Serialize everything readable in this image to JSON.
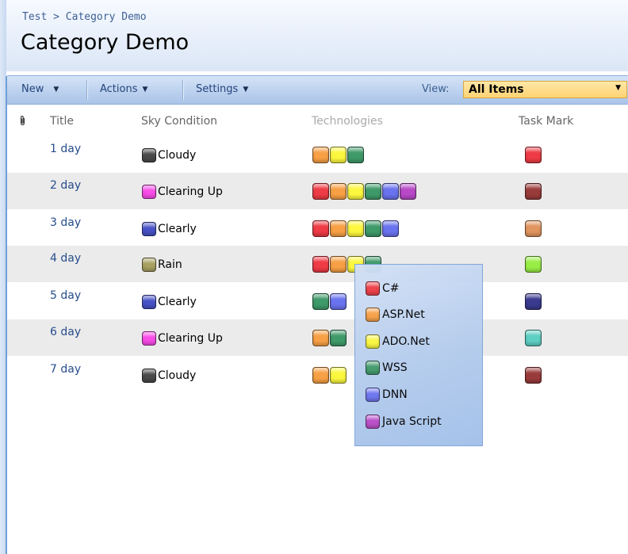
{
  "breadcrumb": {
    "site": "Test",
    "separator": " > ",
    "current": "Category Demo"
  },
  "page_title": "Category Demo",
  "toolbar": {
    "new_label": "New",
    "actions_label": "Actions",
    "settings_label": "Settings",
    "view_label": "View:",
    "view_value": "All Items"
  },
  "columns": {
    "title": "Title",
    "sky": "Sky Condition",
    "tech": "Technologies",
    "task": "Task Mark"
  },
  "colors": {
    "red": "#ee3b45",
    "orange": "#f7a045",
    "yellow": "#fbf73e",
    "green": "#3f9a6a",
    "blue": "#6a73ef",
    "purple": "#b84ac8",
    "gray": "#4a4a4a",
    "pink": "#f94ce8",
    "navy": "#4852c7",
    "olive": "#a8a162",
    "maroon": "#9a3b3b",
    "tan": "#e1955f",
    "lime": "#99ee46",
    "dark_navy": "#3a3a8f",
    "teal": "#5ecfc3",
    "link": "#264d8c",
    "toolbar": "#bcd1ee",
    "view_highlight": "#ffd273"
  },
  "rows": [
    {
      "title": "1 day",
      "sky": "Cloudy",
      "sky_color": "#4a4a4a",
      "tech": [
        "#f7a045",
        "#fbf73e",
        "#3f9a6a"
      ],
      "task": "#ee3b45"
    },
    {
      "title": "2 day",
      "sky": "Clearing Up",
      "sky_color": "#f94ce8",
      "tech": [
        "#ee3b45",
        "#f7a045",
        "#fbf73e",
        "#3f9a6a",
        "#6a73ef",
        "#b84ac8"
      ],
      "task": "#9a3b3b"
    },
    {
      "title": "3 day",
      "sky": "Clearly",
      "sky_color": "#4852c7",
      "tech": [
        "#ee3b45",
        "#f7a045",
        "#fbf73e",
        "#3f9a6a",
        "#6a73ef"
      ],
      "task": "#e1955f"
    },
    {
      "title": "4 day",
      "sky": "Rain",
      "sky_color": "#a8a162",
      "tech": [
        "#ee3b45",
        "#f7a045",
        "#fbf73e",
        "#3f9a6a"
      ],
      "task": "#99ee46"
    },
    {
      "title": "5 day",
      "sky": "Clearly",
      "sky_color": "#4852c7",
      "tech": [
        "#3f9a6a",
        "#6a73ef"
      ],
      "task": "#3a3a8f"
    },
    {
      "title": "6 day",
      "sky": "Clearing Up",
      "sky_color": "#f94ce8",
      "tech": [
        "#f7a045",
        "#3f9a6a"
      ],
      "task": "#5ecfc3"
    },
    {
      "title": "7 day",
      "sky": "Cloudy",
      "sky_color": "#4a4a4a",
      "tech": [
        "#f7a045",
        "#fbf73e"
      ],
      "task": "#9a3b3b"
    }
  ],
  "legend": [
    {
      "label": "C#",
      "color": "#ee3b45"
    },
    {
      "label": "ASP.Net",
      "color": "#f7a045"
    },
    {
      "label": "ADO.Net",
      "color": "#fbf73e"
    },
    {
      "label": "WSS",
      "color": "#3f9a6a"
    },
    {
      "label": "DNN",
      "color": "#6a73ef"
    },
    {
      "label": "Java Script",
      "color": "#b84ac8"
    }
  ],
  "icons": {
    "attachment": "paperclip-icon",
    "dropdown": "chevron-down-icon"
  }
}
